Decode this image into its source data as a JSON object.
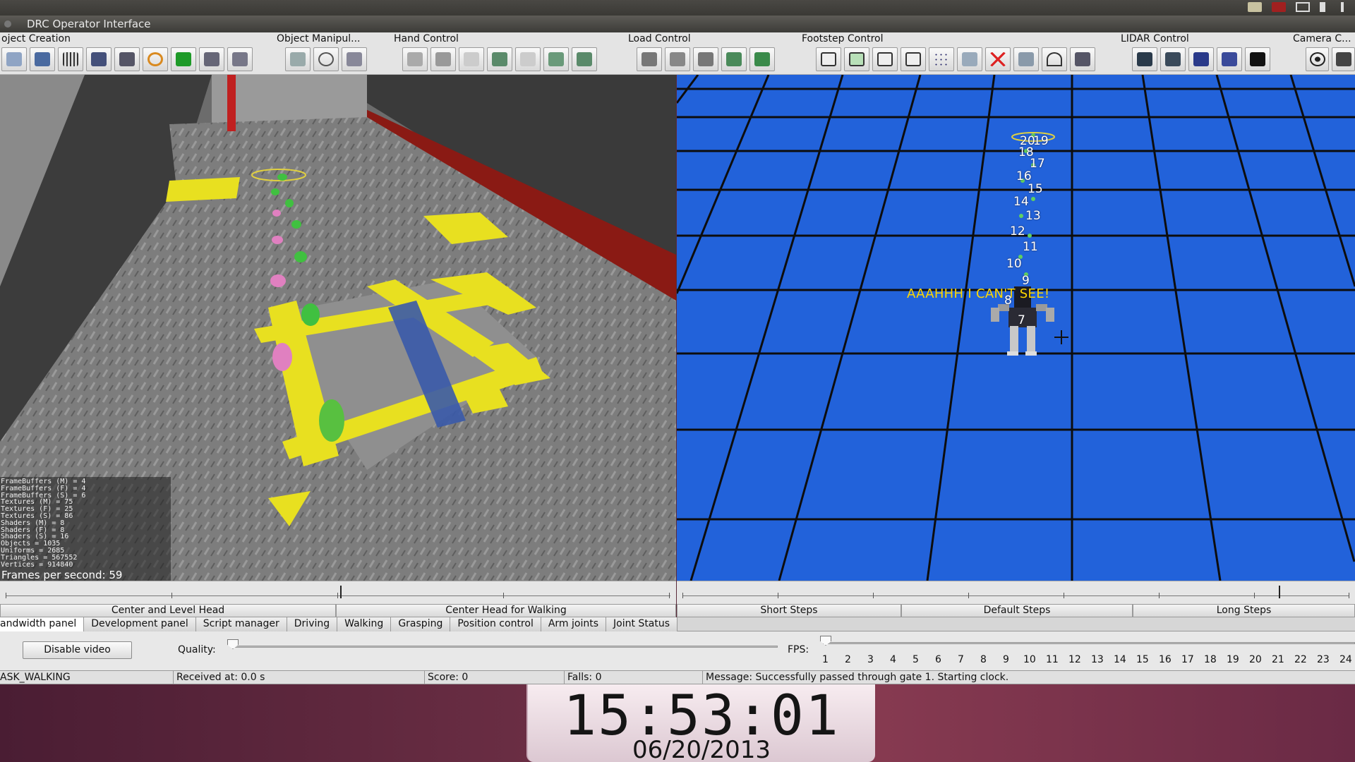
{
  "window": {
    "title": "DRC Operator Interface"
  },
  "toolbar": {
    "groups": [
      {
        "label": "oject Creation"
      },
      {
        "label": "Object Manipul..."
      },
      {
        "label": "Hand Control"
      },
      {
        "label": "Load Control"
      },
      {
        "label": "Footstep Control"
      },
      {
        "label": "LIDAR Control"
      },
      {
        "label": "Camera C..."
      }
    ]
  },
  "left_view": {
    "stats": [
      "FrameBuffers (M) = 4",
      "FrameBuffers (F) = 4",
      "FrameBuffers (S) = 6",
      "Textures (M) = 75",
      "Textures (F) = 25",
      "Textures (S) = 86",
      "Shaders (M) = 8",
      "Shaders (F) = 8",
      "Shaders (S) = 16",
      "Objects = 1035",
      "Uniforms = 2685",
      "Triangles = 567552",
      "Vertices = 914840"
    ],
    "fps_text": "Frames per second: 59"
  },
  "right_view": {
    "warning": "AAAHHH I CAN'T SEE!",
    "footsteps": [
      "20",
      "19",
      "18",
      "17",
      "16",
      "15",
      "14",
      "13",
      "12",
      "11",
      "10",
      "9",
      "8",
      "7"
    ]
  },
  "head_buttons": {
    "center_level": "Center and Level Head",
    "center_walking": "Center Head for Walking"
  },
  "step_buttons": {
    "short": "Short Steps",
    "default": "Default Steps",
    "long": "Long Steps"
  },
  "tabs": [
    "andwidth panel",
    "Development panel",
    "Script manager",
    "Driving",
    "Walking",
    "Grasping",
    "Position control",
    "Arm joints",
    "Joint Status"
  ],
  "bandwidth": {
    "disable_video": "Disable video",
    "quality_label": "Quality:",
    "fps_label": "FPS:",
    "fps_ticks": [
      "1",
      "2",
      "3",
      "4",
      "5",
      "6",
      "7",
      "8",
      "9",
      "10",
      "11",
      "12",
      "13",
      "14",
      "15",
      "16",
      "17",
      "18",
      "19",
      "20",
      "21",
      "22",
      "23",
      "24"
    ]
  },
  "status": {
    "task": "ASK_WALKING",
    "received": "Received at:  0.0 s",
    "score": "Score:  0",
    "falls": "Falls:  0",
    "message": "Message:  Successfully passed through gate 1. Starting clock."
  },
  "clock": {
    "time": "15:53:01",
    "date": "06/20/2013"
  },
  "colors": {
    "grid_floor": "#2060d8",
    "warning": "#ffd800",
    "floor_marking": "#e8e020"
  }
}
